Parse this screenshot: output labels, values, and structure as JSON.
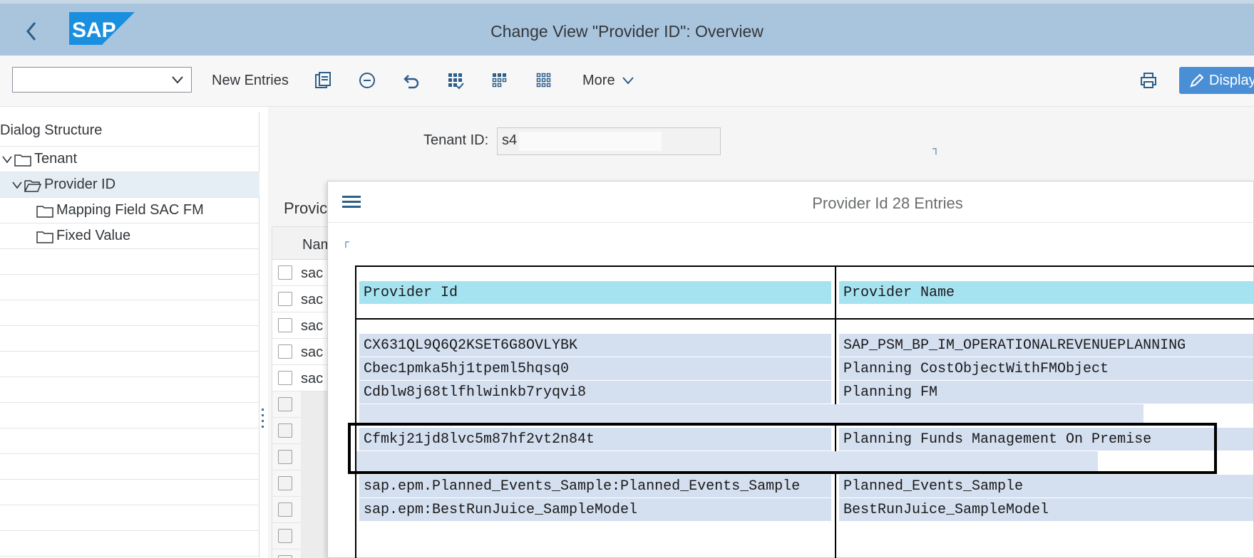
{
  "shell": {
    "title": "Change View \"Provider ID\": Overview",
    "logo_text": "SAP",
    "colors": {
      "shell_bg": "#a9c5de",
      "logo_blue": "#1a8fe0"
    }
  },
  "toolbar": {
    "select_value": "",
    "new_entries": "New Entries",
    "more": "More",
    "display": "Display",
    "icons": [
      "copy-icon",
      "remove-icon",
      "undo-icon",
      "select-all-icon",
      "select-block-icon",
      "deselect-all-icon",
      "print-icon",
      "edit-icon"
    ]
  },
  "dialog_structure": {
    "title": "Dialog Structure",
    "items": [
      {
        "label": "Tenant",
        "expanded": true
      },
      {
        "label": "Provider ID",
        "expanded": true,
        "selected": true
      },
      {
        "label": "Mapping Field SAC FM"
      },
      {
        "label": "Fixed Value"
      }
    ]
  },
  "form": {
    "tenant_label": "Tenant ID:",
    "tenant_value": "s4"
  },
  "background_table": {
    "heading": "Provic",
    "column_header": "Nam",
    "rows": [
      "sac",
      "sac",
      "sac",
      "sac",
      "sac"
    ]
  },
  "dialog": {
    "title": "Provider Id 28 Entries",
    "columns": [
      "Provider Id",
      "Provider Name"
    ],
    "rows": [
      {
        "id": "CX631QL9Q6Q2KSET6G8OVLYBK",
        "name": "SAP_PSM_BP_IM_OPERATIONALREVENUEPLANNING"
      },
      {
        "id": "Cbec1pmka5hj1tpeml5hqsq0",
        "name": "Planning CostObjectWithFMObject"
      },
      {
        "id": "Cdblw8j68tlfhlwinkb7ryqvi8",
        "name": "Planning FM"
      },
      {
        "id": "Cfmkj21jd8lvc5m87hf2vt2n84t",
        "name": "Planning Funds Management On Premise"
      },
      {
        "id": "sap.epm.Planned_Events_Sample:Planned_Events_Sample",
        "name": "Planned_Events_Sample"
      },
      {
        "id": "sap.epm:BestRunJuice_SampleModel",
        "name": "BestRunJuice_SampleModel"
      }
    ]
  }
}
